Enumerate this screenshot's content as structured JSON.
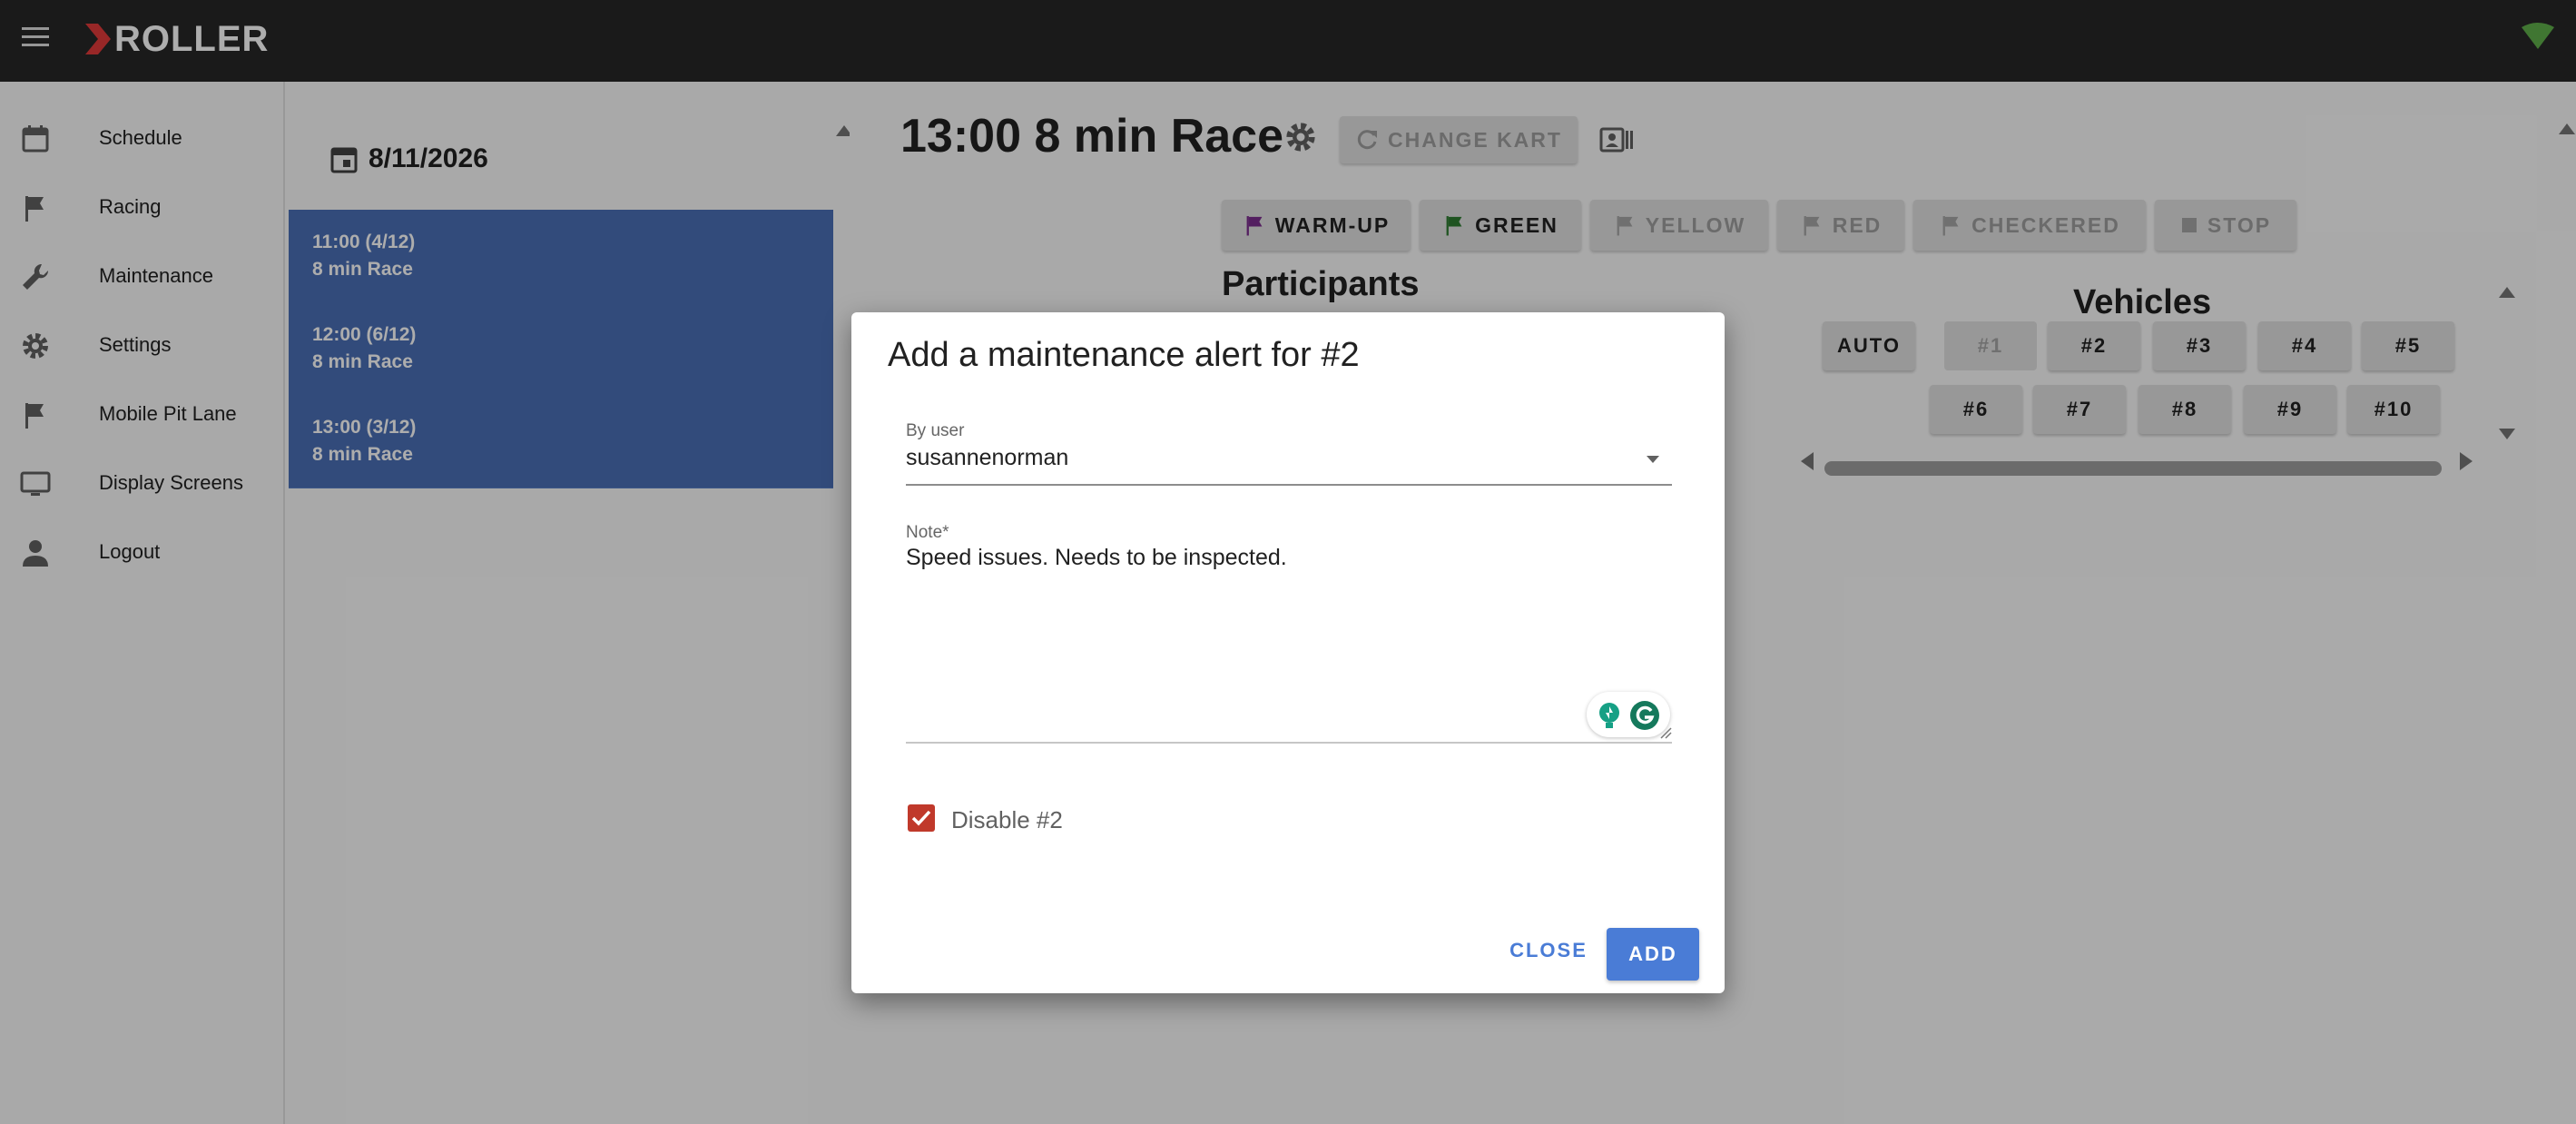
{
  "app": {
    "logo_text": "ROLLER"
  },
  "colors": {
    "appbar": "#272727",
    "selected_race": "#4a6fb5",
    "accent": "#4a7cd6",
    "checkbox": "#c0392b",
    "warmup_flag": "#7b2d8e",
    "green_flag": "#2e7d32"
  },
  "nav": {
    "items": [
      {
        "label": "Schedule",
        "icon": "calendar-icon"
      },
      {
        "label": "Racing",
        "icon": "flag-icon"
      },
      {
        "label": "Maintenance",
        "icon": "wrench-icon"
      },
      {
        "label": "Settings",
        "icon": "gear-icon"
      },
      {
        "label": "Mobile Pit Lane",
        "icon": "flag-icon"
      },
      {
        "label": "Display Screens",
        "icon": "monitor-icon"
      },
      {
        "label": "Logout",
        "icon": "person-icon"
      }
    ]
  },
  "schedule": {
    "date": "8/11/2026",
    "races": [
      {
        "time": "11:00 (4/12)",
        "name": "8 min Race"
      },
      {
        "time": "12:00 (6/12)",
        "name": "8 min Race"
      },
      {
        "time": "13:00 (3/12)",
        "name": "8 min Race"
      }
    ]
  },
  "race": {
    "title": "13:00 8 min Race",
    "change_kart": "CHANGE KART",
    "flags": {
      "warmup": "WARM-UP",
      "green": "GREEN",
      "yellow": "YELLOW",
      "red": "RED",
      "checkered": "CHECKERED",
      "stop": "STOP"
    },
    "participants_heading": "Participants",
    "vehicles_heading": "Vehicles",
    "vehicles": [
      "AUTO",
      "#1",
      "#2",
      "#3",
      "#4",
      "#5",
      "#6",
      "#7",
      "#8",
      "#9",
      "#10"
    ]
  },
  "dialog": {
    "title": "Add a maintenance alert for #2",
    "user_label": "By user",
    "user_value": "susannenorman",
    "note_label": "Note*",
    "note_value": "Speed issues. Needs to be inspected.",
    "checkbox_label": "Disable #2",
    "checkbox_checked": true,
    "close_label": "CLOSE",
    "add_label": "ADD"
  }
}
